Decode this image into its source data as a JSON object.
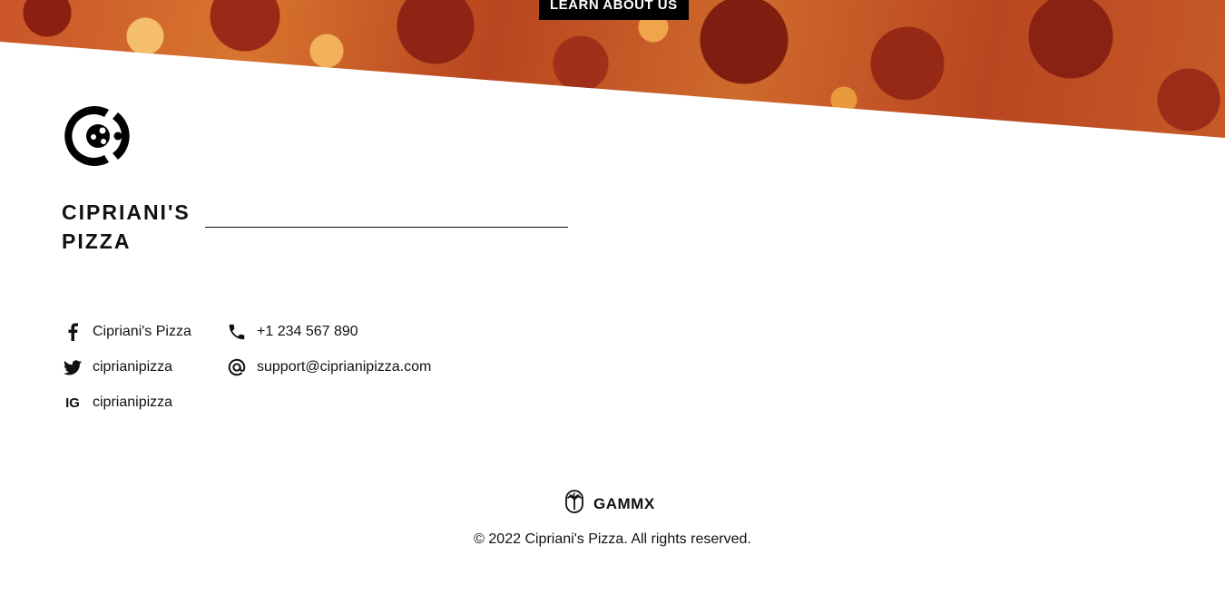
{
  "hero": {
    "cta_label": "LEARN ABOUT US"
  },
  "brand": {
    "name": "CIPRIANI'S PIZZA",
    "logo_icon": "cipriani-logo-icon"
  },
  "social": [
    {
      "icon": "facebook-icon",
      "label": "Cipriani's Pizza"
    },
    {
      "icon": "twitter-icon",
      "label": "ciprianipizza"
    },
    {
      "icon": "instagram-icon",
      "icon_text": "IG",
      "label": "ciprianipizza"
    }
  ],
  "contact": [
    {
      "icon": "phone-icon",
      "label": "+1 234 567 890"
    },
    {
      "icon": "at-icon",
      "label": "support@ciprianipizza.com"
    }
  ],
  "footer": {
    "credit_icon": "palm-tree-icon",
    "credit_name": "GAMMX",
    "copyright": "© 2022 Cipriani's Pizza. All rights reserved."
  },
  "colors": {
    "text": "#111111",
    "background": "#ffffff",
    "cta_background": "#000000"
  }
}
